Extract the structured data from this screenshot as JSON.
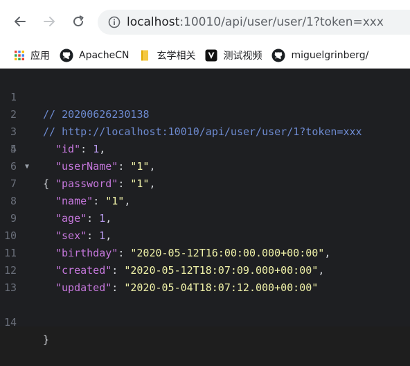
{
  "browser": {
    "url_host": "localhost",
    "url_path": ":10010/api/user/user/1?token=xxx",
    "bookmarks": [
      {
        "label": "应用",
        "icon": "apps-grid-icon"
      },
      {
        "label": "ApacheCN",
        "icon": "github-icon"
      },
      {
        "label": "玄学相关",
        "icon": "folder-icon"
      },
      {
        "label": "测试视频",
        "icon": "v-logo-icon"
      },
      {
        "label": "miguelgrinberg/",
        "icon": "github-icon"
      }
    ]
  },
  "editor": {
    "line_numbers": [
      "1",
      "2",
      "3",
      "4",
      "5",
      "6",
      "7",
      "8",
      "9",
      "10",
      "11",
      "12",
      "13",
      "14"
    ],
    "comment_timestamp": "// 20200626230138",
    "comment_url": "// http://localhost:10010/api/user/user/1?token=xxx",
    "open_brace": "{",
    "close_brace": "}",
    "fields": [
      {
        "key": "\"id\"",
        "value": "1",
        "value_type": "num",
        "comma": ","
      },
      {
        "key": "\"userName\"",
        "value": "\"1\"",
        "value_type": "str",
        "comma": ","
      },
      {
        "key": "\"password\"",
        "value": "\"1\"",
        "value_type": "str",
        "comma": ","
      },
      {
        "key": "\"name\"",
        "value": "\"1\"",
        "value_type": "str",
        "comma": ","
      },
      {
        "key": "\"age\"",
        "value": "1",
        "value_type": "num",
        "comma": ","
      },
      {
        "key": "\"sex\"",
        "value": "1",
        "value_type": "num",
        "comma": ","
      },
      {
        "key": "\"birthday\"",
        "value": "\"2020-05-12T16:00:00.000+00:00\"",
        "value_type": "str",
        "comma": ","
      },
      {
        "key": "\"created\"",
        "value": "\"2020-05-12T18:07:09.000+00:00\"",
        "value_type": "str",
        "comma": ","
      },
      {
        "key": "\"updated\"",
        "value": "\"2020-05-04T18:07:12.000+00:00\"",
        "value_type": "str",
        "comma": ""
      }
    ],
    "colors": {
      "background": "#1e1f22",
      "comment": "#6d8ad0",
      "key": "#c678dd",
      "string": "#f0f2a8",
      "number": "#b99bf0"
    }
  }
}
